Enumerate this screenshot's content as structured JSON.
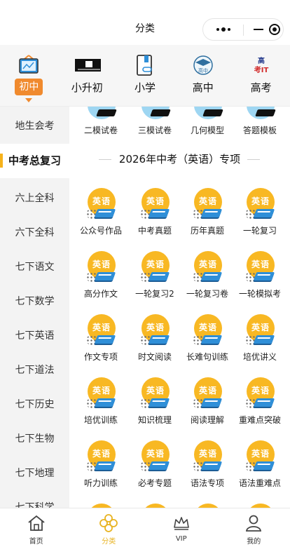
{
  "window": {
    "title": "分类"
  },
  "tabs": [
    {
      "label": "初中",
      "icon": "blackboard-icon",
      "active": true
    },
    {
      "label": "小升初",
      "icon": "school-banner-icon",
      "active": false
    },
    {
      "label": "小学",
      "icon": "bookmark-book-icon",
      "active": false
    },
    {
      "label": "高中",
      "icon": "graduation-cap-icon",
      "active": false
    },
    {
      "label": "高考",
      "icon": "exam-logo-icon",
      "active": false
    }
  ],
  "sidebar": {
    "items": [
      {
        "label": "地生会考",
        "active": false
      },
      {
        "label": "中考总复习",
        "active": true
      },
      {
        "label": "六上全科",
        "active": false
      },
      {
        "label": "六下全科",
        "active": false
      },
      {
        "label": "七下语文",
        "active": false
      },
      {
        "label": "七下数学",
        "active": false
      },
      {
        "label": "七下英语",
        "active": false
      },
      {
        "label": "七下道法",
        "active": false
      },
      {
        "label": "七下历史",
        "active": false
      },
      {
        "label": "七下生物",
        "active": false
      },
      {
        "label": "七下地理",
        "active": false
      },
      {
        "label": "七下科学",
        "active": false
      }
    ]
  },
  "content": {
    "top_row": [
      "二模试卷",
      "三模试卷",
      "几何模型",
      "答题模板"
    ],
    "section_title": "2026年中考（英语）专项",
    "icon_word": "英语",
    "grid": [
      [
        "公众号作品",
        "中考真题",
        "历年真题",
        "一轮复习"
      ],
      [
        "高分作文",
        "一轮复习2",
        "一轮复习卷",
        "一轮模拟考"
      ],
      [
        "作文专项",
        "时文阅读",
        "长难句训练",
        "培优讲义"
      ],
      [
        "培优训练",
        "知识梳理",
        "阅读理解",
        "重难点突破"
      ],
      [
        "听力训练",
        "必考专题",
        "语法专项",
        "语法重难点"
      ]
    ]
  },
  "bottom_nav": [
    {
      "label": "首页",
      "icon": "home-icon",
      "active": false
    },
    {
      "label": "分类",
      "icon": "category-icon",
      "active": true
    },
    {
      "label": "VIP",
      "icon": "crown-icon",
      "active": false
    },
    {
      "label": "我的",
      "icon": "user-icon",
      "active": false
    }
  ],
  "colors": {
    "accent": "#f08a2e",
    "highlight": "#f6b21b",
    "icon_disc": "#f8b823",
    "book_blue": "#2f8fd8"
  }
}
